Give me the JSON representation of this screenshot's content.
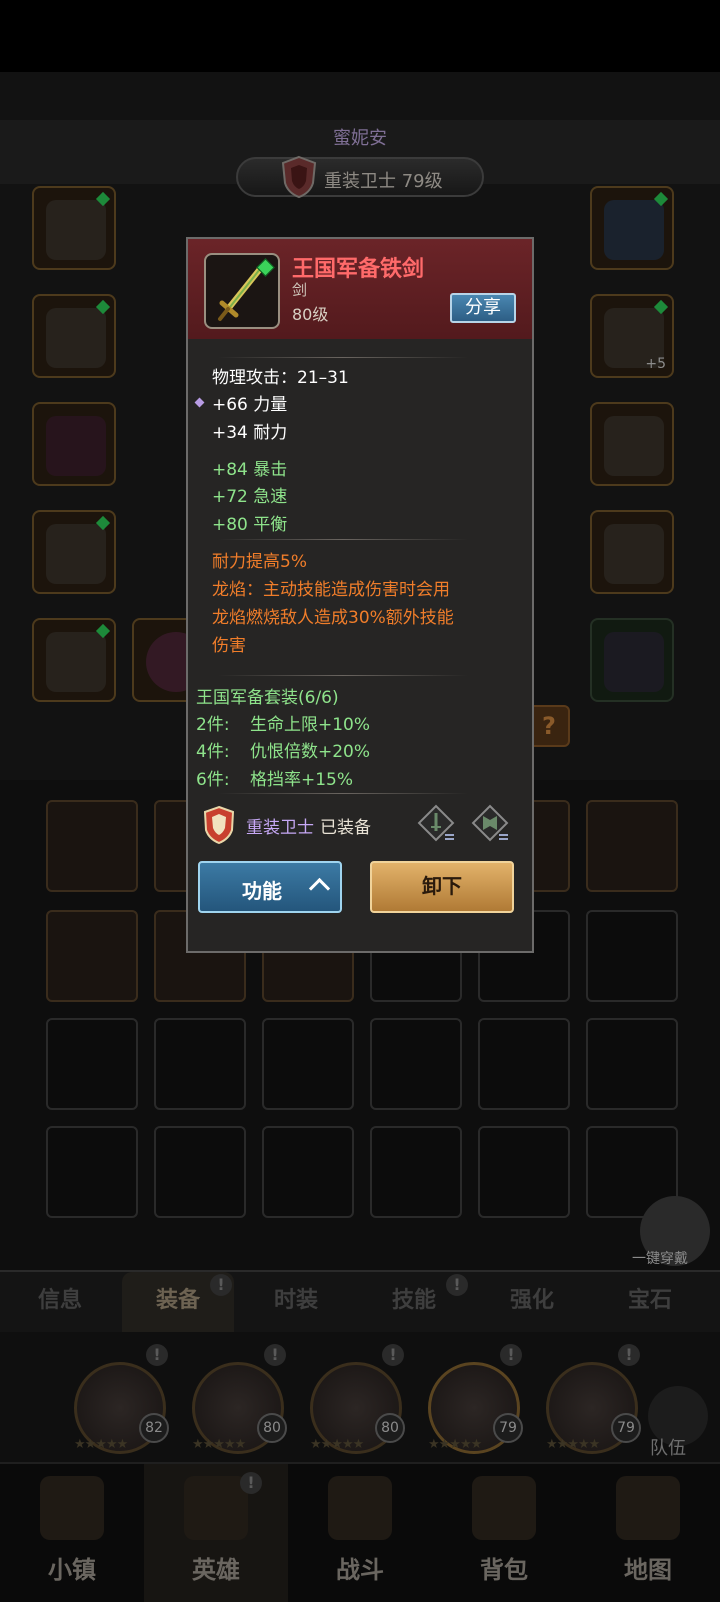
{
  "hero": {
    "name": "蜜妮安",
    "class_level": "重装卫士 79级"
  },
  "item": {
    "name": "王国军备铁剑",
    "type": "剑",
    "level": "80级",
    "share_label": "分享",
    "base_stat": "物理攻击：21–31",
    "primary_stats": [
      "+66 力量",
      "+34 耐力"
    ],
    "secondary_stats": [
      "+84 暴击",
      "+72 急速",
      "+80 平衡"
    ],
    "special_effects": [
      "耐力提高5%",
      "龙焰：主动技能造成伤害时会用",
      "龙焰燃烧敌人造成30%额外技能",
      "伤害"
    ],
    "set": {
      "title": "王国军备套装(6/6)",
      "bonuses": [
        {
          "pieces": "2件:",
          "effect": "生命上限+10%"
        },
        {
          "pieces": "4件:",
          "effect": "仇恨倍数+20%"
        },
        {
          "pieces": "6件:",
          "effect": "格挡率+15%"
        }
      ]
    },
    "equipped_by_class": "重装卫士",
    "equipped_status": "已装备",
    "function_label": "功能",
    "unequip_label": "卸下"
  },
  "background_slot_badge": "+5",
  "help_symbol": "?",
  "auto_equip_label": "一键穿戴",
  "tabs": [
    "信息",
    "装备",
    "时装",
    "技能",
    "强化",
    "宝石"
  ],
  "tab_alert_symbol": "!",
  "roster": [
    {
      "level": "82"
    },
    {
      "level": "80"
    },
    {
      "level": "80"
    },
    {
      "level": "79"
    },
    {
      "level": "79"
    }
  ],
  "team_label": "队伍",
  "nav": [
    "小镇",
    "英雄",
    "战斗",
    "背包",
    "地图"
  ],
  "colors": {
    "rare_name": "#ff6a6a",
    "green_stat": "#8ee38b",
    "orange_effect": "#f07d2a",
    "popup_header": "#6b2428"
  }
}
